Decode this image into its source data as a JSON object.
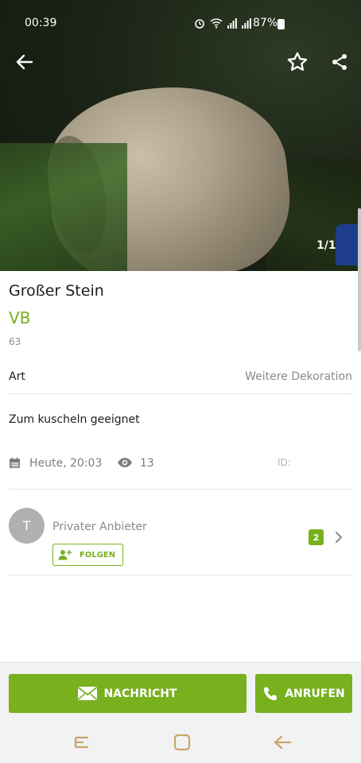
{
  "status_bar": {
    "time": "00:39",
    "battery": "87%",
    "icons": [
      "alarm-icon",
      "wifi-icon",
      "signal-icon",
      "signal-icon",
      "battery-icon"
    ]
  },
  "toolbar": {
    "back_icon": "arrow-left-icon",
    "favorite_icon": "star-outline-icon",
    "share_icon": "share-icon"
  },
  "gallery": {
    "counter": "1/1"
  },
  "listing": {
    "title": "Großer Stein",
    "price": "VB",
    "location": "63"
  },
  "attributes": [
    {
      "key": "Art",
      "value": "Weitere Dekoration"
    }
  ],
  "description": "Zum kuscheln geeignet",
  "meta": {
    "date": "Heute, 20:03",
    "views": "13",
    "id_label": "ID:"
  },
  "seller": {
    "avatar_initial": "T",
    "type": "Privater Anbieter",
    "follow_label": "FOLGEN",
    "listing_count": "2"
  },
  "actions": {
    "message_label": "NACHRICHT",
    "call_label": "ANRUFEN"
  },
  "colors": {
    "accent": "#78b01e",
    "text_primary": "#1e1e1e",
    "text_secondary": "#8a8a8a"
  }
}
